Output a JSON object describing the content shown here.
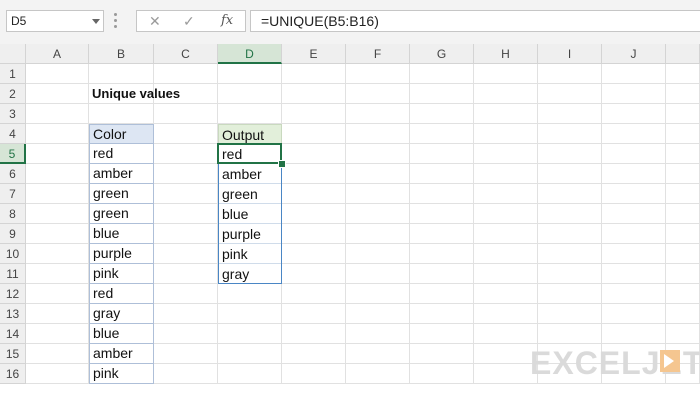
{
  "formula_bar": {
    "name_box": "D5",
    "cancel_icon": "close-icon",
    "enter_icon": "check-icon",
    "fx_label": "fx",
    "formula": "=UNIQUE(B5:B16)"
  },
  "columns": [
    "A",
    "B",
    "C",
    "D",
    "E",
    "F",
    "G",
    "H",
    "I",
    "J"
  ],
  "rows": [
    "1",
    "2",
    "3",
    "4",
    "5",
    "6",
    "7",
    "8",
    "9",
    "10",
    "11",
    "12",
    "13",
    "14",
    "15",
    "16"
  ],
  "selected": {
    "column": "D",
    "row": "5"
  },
  "title": "Unique values",
  "color_table": {
    "header": "Color",
    "values": [
      "red",
      "amber",
      "green",
      "green",
      "blue",
      "purple",
      "pink",
      "red",
      "gray",
      "blue",
      "amber",
      "pink"
    ]
  },
  "output_table": {
    "header": "Output",
    "values": [
      "red",
      "amber",
      "green",
      "blue",
      "purple",
      "pink",
      "gray"
    ]
  },
  "logo": {
    "text": "EXCELJET",
    "color": "#dadada",
    "accent": "#f5c690"
  },
  "colors": {
    "accent": "#217346",
    "table_header": "#dde6f3",
    "output_header": "#e2efda"
  }
}
